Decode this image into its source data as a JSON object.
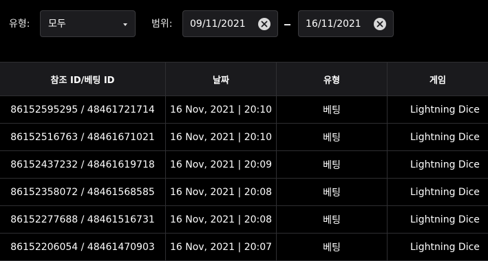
{
  "filters": {
    "type_label": "유형:",
    "type_value": "모두",
    "range_label": "범위:",
    "date_from": "09/11/2021",
    "date_to": "16/11/2021",
    "separator": "–"
  },
  "table": {
    "headers": [
      "참조 ID/베팅 ID",
      "날짜",
      "유형",
      "게임"
    ],
    "rows": [
      {
        "ids": "86152595295 / 48461721714",
        "date": "16 Nov, 2021 | 20:10",
        "type": "베팅",
        "game": "Lightning Dice"
      },
      {
        "ids": "86152516763 / 48461671021",
        "date": "16 Nov, 2021 | 20:10",
        "type": "베팅",
        "game": "Lightning Dice"
      },
      {
        "ids": "86152437232 / 48461619718",
        "date": "16 Nov, 2021 | 20:09",
        "type": "베팅",
        "game": "Lightning Dice"
      },
      {
        "ids": "86152358072 / 48461568585",
        "date": "16 Nov, 2021 | 20:08",
        "type": "베팅",
        "game": "Lightning Dice"
      },
      {
        "ids": "86152277688 / 48461516731",
        "date": "16 Nov, 2021 | 20:08",
        "type": "베팅",
        "game": "Lightning Dice"
      },
      {
        "ids": "86152206054 / 48461470903",
        "date": "16 Nov, 2021 | 20:07",
        "type": "베팅",
        "game": "Lightning Dice"
      }
    ]
  }
}
